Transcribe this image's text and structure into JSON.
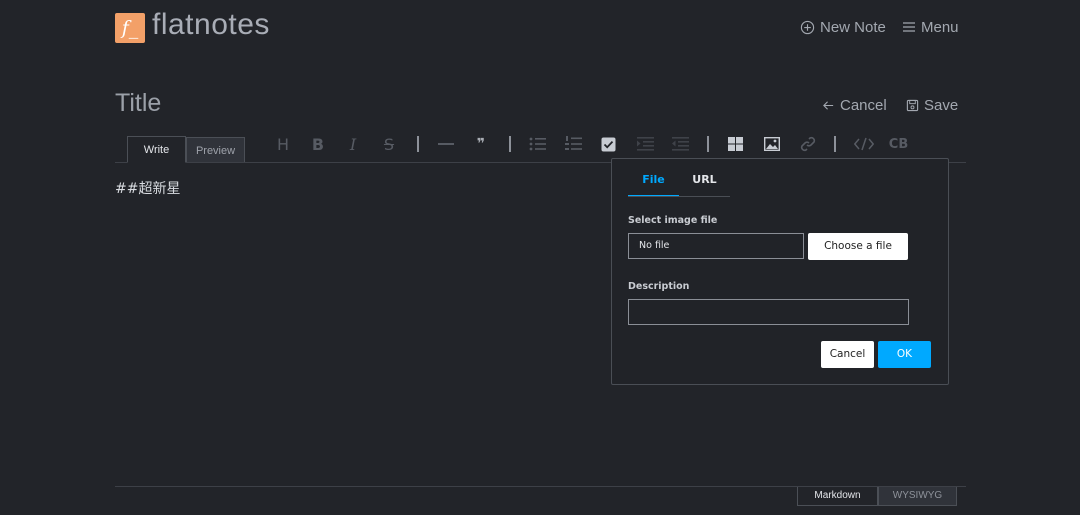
{
  "app": {
    "logo_glyph": "f_",
    "logo_text": "flatnotes",
    "brand_color": "#f3a068"
  },
  "header": {
    "new_note": "New Note",
    "menu": "Menu"
  },
  "note": {
    "title": "Title",
    "cancel": "Cancel",
    "save": "Save",
    "content": "##超新星"
  },
  "editor": {
    "tabs": [
      "Write",
      "Preview"
    ],
    "active_tab": "Write",
    "toolbar": [
      "heading-icon",
      "bold-icon",
      "italic-icon",
      "strike-icon",
      "horizontal-rule-icon",
      "quote-icon",
      "bullet-list-icon",
      "ordered-list-icon",
      "task-icon",
      "indent-icon",
      "outdent-icon",
      "table-icon",
      "image-icon",
      "link-icon",
      "code-icon",
      "codeblock-icon"
    ],
    "codeblock_label": "CB",
    "modes": [
      "Markdown",
      "WYSIWYG"
    ],
    "active_mode": "Markdown"
  },
  "image_dialog": {
    "tabs": [
      "File",
      "URL"
    ],
    "active_tab": "File",
    "accent_color": "#00a9ff",
    "select_label": "Select image file",
    "file_value": "No file",
    "choose_button": "Choose a file",
    "description_label": "Description",
    "description_value": "",
    "cancel": "Cancel",
    "ok": "OK"
  }
}
